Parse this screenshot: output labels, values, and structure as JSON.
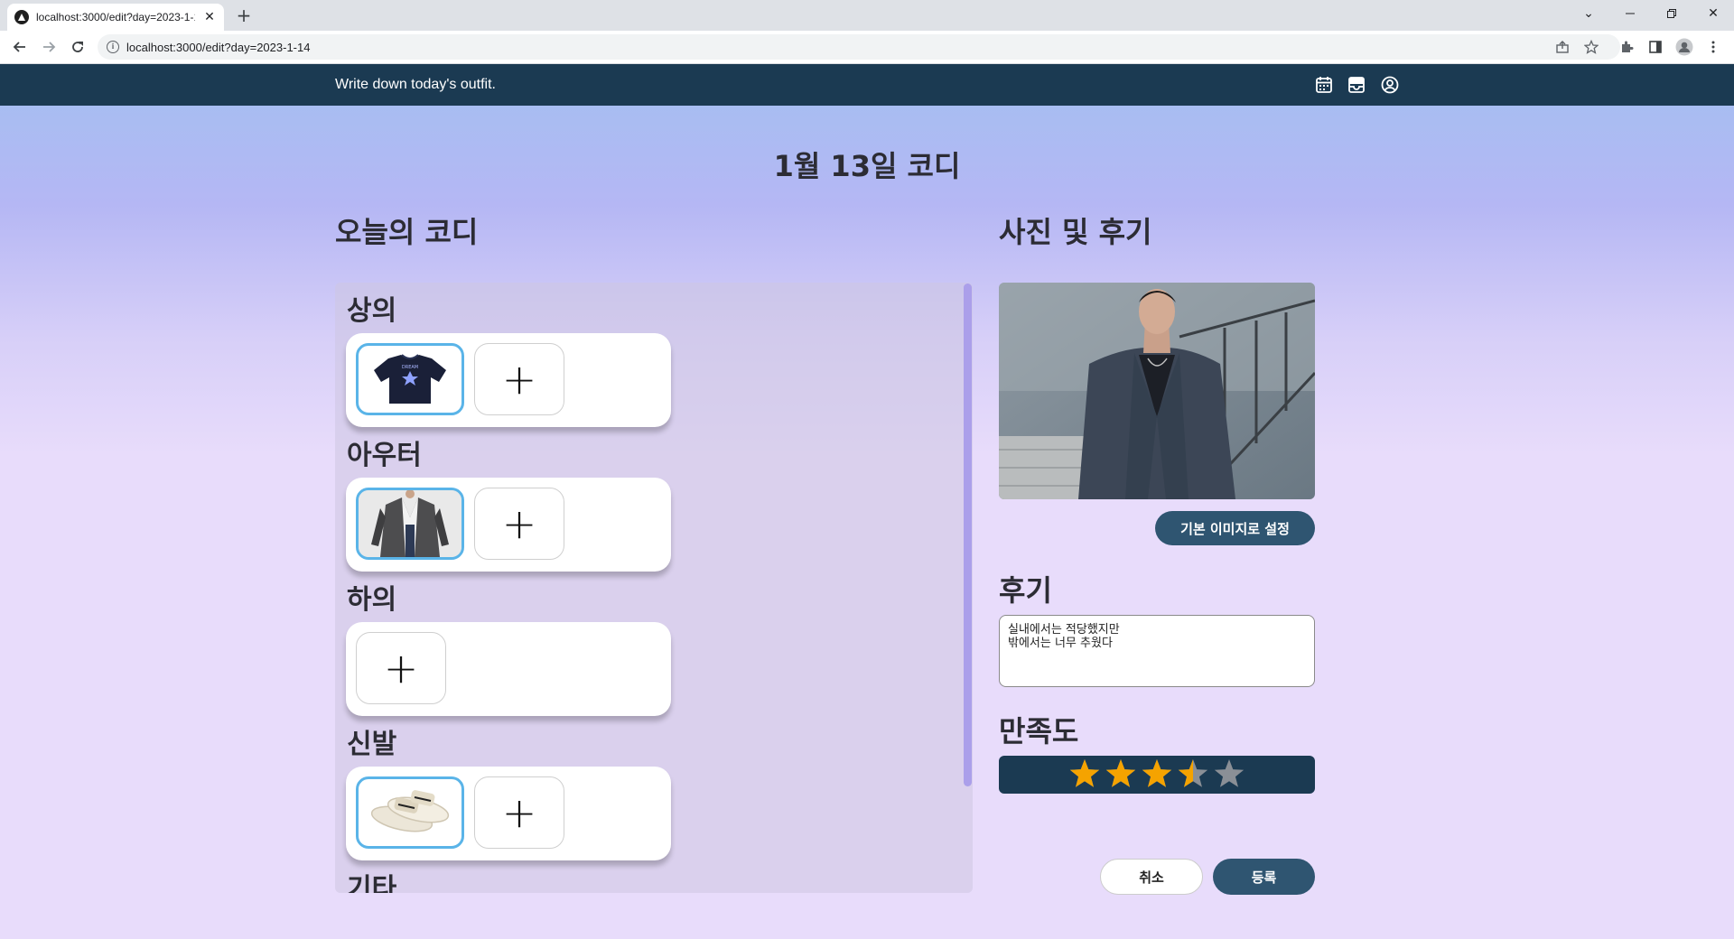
{
  "browser": {
    "tab_title": "localhost:3000/edit?day=2023-1-14",
    "url": "localhost:3000/edit?day=2023-1-14"
  },
  "header": {
    "brand": "Write down today's outfit."
  },
  "page": {
    "title": "1월 13일 코디",
    "left_heading": "오늘의 코디",
    "right_heading": "사진 및 후기"
  },
  "categories": [
    {
      "label": "상의",
      "has_item": true,
      "item": "navy-tshirt"
    },
    {
      "label": "아우터",
      "has_item": true,
      "item": "gray-blazer"
    },
    {
      "label": "하의",
      "has_item": false
    },
    {
      "label": "신발",
      "has_item": true,
      "item": "white-slides"
    },
    {
      "label": "기타",
      "has_item": false
    }
  ],
  "add_symbol": "+",
  "photo_section": {
    "default_image_button": "기본 이미지로 설정",
    "review_heading": "후기",
    "review_text": "실내에서는 적당했지만\n밖에서는 너무 추웠다",
    "satisfaction_heading": "만족도",
    "rating": 3.5,
    "rating_max": 5,
    "star_filled_color": "#f5a300",
    "star_empty_color": "#8a8f96"
  },
  "actions": {
    "cancel": "취소",
    "submit": "등록"
  }
}
